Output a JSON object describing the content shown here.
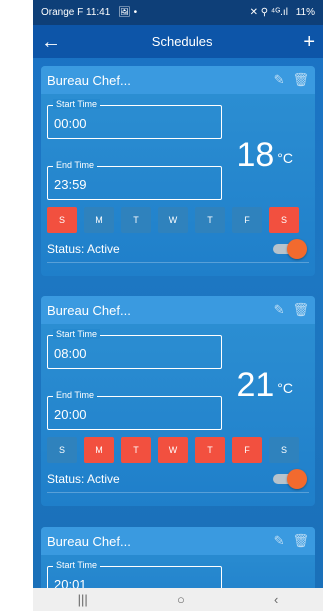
{
  "status_bar": {
    "carrier_time": "Orange F 11:41",
    "left_icons": "🖼  •",
    "right_icons": "✕ ⚲ ⁴ᴳ.ıl",
    "battery": "11%"
  },
  "app_bar": {
    "title": "Schedules",
    "back_icon": "←",
    "add_icon": "+"
  },
  "schedules": [
    {
      "name": "Bureau Chef...",
      "start_label": "Start Time",
      "start_value": "00:00",
      "end_label": "End Time",
      "end_value": "23:59",
      "temperature": "18",
      "unit": "°C",
      "days": [
        {
          "label": "S",
          "active": true
        },
        {
          "label": "M",
          "active": false
        },
        {
          "label": "T",
          "active": false
        },
        {
          "label": "W",
          "active": false
        },
        {
          "label": "T",
          "active": false
        },
        {
          "label": "F",
          "active": false
        },
        {
          "label": "S",
          "active": true
        }
      ],
      "status": "Status: Active",
      "switch_on": true
    },
    {
      "name": "Bureau Chef...",
      "start_label": "Start Time",
      "start_value": "08:00",
      "end_label": "End Time",
      "end_value": "20:00",
      "temperature": "21",
      "unit": "°C",
      "days": [
        {
          "label": "S",
          "active": false
        },
        {
          "label": "M",
          "active": true
        },
        {
          "label": "T",
          "active": true
        },
        {
          "label": "W",
          "active": true
        },
        {
          "label": "T",
          "active": true
        },
        {
          "label": "F",
          "active": true
        },
        {
          "label": "S",
          "active": false
        }
      ],
      "status": "Status: Active",
      "switch_on": true
    },
    {
      "name": "Bureau Chef...",
      "start_label": "Start Time",
      "start_value": "20:01"
    }
  ],
  "icons": {
    "edit": "✎",
    "delete": "🗑"
  },
  "nav_bar": {
    "recent": "|||",
    "home": "○",
    "back": "‹"
  },
  "colors": {
    "accent_on": "#f2503f",
    "day_off": "#2f82bd",
    "switch_knob": "#f26a2e",
    "app_bar": "#0d55a8"
  }
}
